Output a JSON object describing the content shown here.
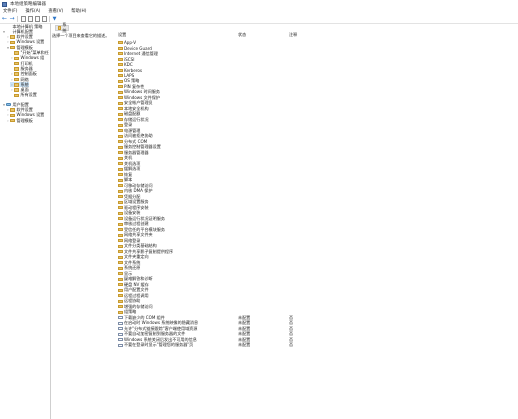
{
  "window": {
    "title": "本地组策略编辑器"
  },
  "menu": [
    "文件(F)",
    "操作(A)",
    "查看(V)",
    "帮助(H)"
  ],
  "toolbar": {
    "icons": [
      "back-arrow-icon",
      "forward-arrow-icon",
      "show-hide-tree-icon",
      "properties-icon",
      "help-icon",
      "export-list-icon",
      "filter-icon"
    ]
  },
  "tree": {
    "items": [
      {
        "label": "本地计算机 策略",
        "icon": "computer",
        "expander": ""
      },
      {
        "label": "计算机配置",
        "icon": "computer",
        "expander": "▾"
      },
      {
        "label": "软件设置",
        "icon": "folder",
        "expander": "›"
      },
      {
        "label": "Windows 设置",
        "icon": "folder",
        "expander": "›"
      },
      {
        "label": "管理模板",
        "icon": "folder",
        "expander": "▾"
      },
      {
        "label": "\"开始\"菜单和任",
        "icon": "folder",
        "expander": ""
      },
      {
        "label": "Windows 组",
        "icon": "folder",
        "expander": "›"
      },
      {
        "label": "打印机",
        "icon": "folder",
        "expander": ""
      },
      {
        "label": "服务器",
        "icon": "folder",
        "expander": ""
      },
      {
        "label": "控制面板",
        "icon": "folder",
        "expander": "›"
      },
      {
        "label": "网络",
        "icon": "folder",
        "expander": "›"
      },
      {
        "label": "系统",
        "icon": "folder",
        "expander": "›",
        "selected": true
      },
      {
        "label": "桌面",
        "icon": "folder",
        "expander": "›"
      },
      {
        "label": "所有设置",
        "icon": "folder",
        "expander": ""
      },
      {
        "label": "用户配置",
        "icon": "user",
        "expander": "▾"
      },
      {
        "label": "软件设置",
        "icon": "folder",
        "expander": "›"
      },
      {
        "label": "Windows 设置",
        "icon": "folder",
        "expander": "›"
      },
      {
        "label": "管理模板",
        "icon": "folder",
        "expander": "›"
      }
    ]
  },
  "tab": {
    "label": "系统"
  },
  "description": "选择一个项目来查看它的描述。",
  "columns": {
    "setting": "设置",
    "state": "状态",
    "comment": "注释"
  },
  "rows": [
    {
      "name": "App-V",
      "type": "folder"
    },
    {
      "name": "Device Guard",
      "type": "folder"
    },
    {
      "name": "Internet 通信管理",
      "type": "folder"
    },
    {
      "name": "iSCSI",
      "type": "folder"
    },
    {
      "name": "KDC",
      "type": "folder"
    },
    {
      "name": "Kerberos",
      "type": "folder"
    },
    {
      "name": "LAPS",
      "type": "folder"
    },
    {
      "name": "OS 策略",
      "type": "folder"
    },
    {
      "name": "PIN 复杂性",
      "type": "folder"
    },
    {
      "name": "Windows 时间服务",
      "type": "folder"
    },
    {
      "name": "Windows 文件保护",
      "type": "folder"
    },
    {
      "name": "安全帐户管理员",
      "type": "folder"
    },
    {
      "name": "本地安全机构",
      "type": "folder"
    },
    {
      "name": "磁盘配额",
      "type": "folder"
    },
    {
      "name": "存储运行状况",
      "type": "folder"
    },
    {
      "name": "登录",
      "type": "folder"
    },
    {
      "name": "电源管理",
      "type": "folder"
    },
    {
      "name": "访问被拒绝协助",
      "type": "folder"
    },
    {
      "name": "分布式 COM",
      "type": "folder"
    },
    {
      "name": "服务控制管理器设置",
      "type": "folder"
    },
    {
      "name": "服务器管理器",
      "type": "folder"
    },
    {
      "name": "关机",
      "type": "folder"
    },
    {
      "name": "关机选项",
      "type": "folder"
    },
    {
      "name": "缓解选项",
      "type": "folder"
    },
    {
      "name": "恢复",
      "type": "folder"
    },
    {
      "name": "脚本",
      "type": "folder"
    },
    {
      "name": "可移动存储访问",
      "type": "folder"
    },
    {
      "name": "内核 DMA 保护",
      "type": "folder"
    },
    {
      "name": "凭据分配",
      "type": "folder"
    },
    {
      "name": "区域设置服务",
      "type": "folder"
    },
    {
      "name": "驱动程序安装",
      "type": "folder"
    },
    {
      "name": "设备安装",
      "type": "folder"
    },
    {
      "name": "设备运行状况证明服务",
      "type": "folder"
    },
    {
      "name": "审核过程创建",
      "type": "folder"
    },
    {
      "name": "受信任的平台模块服务",
      "type": "folder"
    },
    {
      "name": "网络共享文件夹",
      "type": "folder"
    },
    {
      "name": "网络登录",
      "type": "folder"
    },
    {
      "name": "文件分类基础结构",
      "type": "folder"
    },
    {
      "name": "文件共享影子复制提供程序",
      "type": "folder"
    },
    {
      "name": "文件夹重定向",
      "type": "folder"
    },
    {
      "name": "文件系统",
      "type": "folder"
    },
    {
      "name": "系统还原",
      "type": "folder"
    },
    {
      "name": "显示",
      "type": "folder"
    },
    {
      "name": "疑难解答和诊断",
      "type": "folder"
    },
    {
      "name": "硬盘 NV 缓存",
      "type": "folder"
    },
    {
      "name": "用户配置文件",
      "type": "folder"
    },
    {
      "name": "远程过程调用",
      "type": "folder"
    },
    {
      "name": "远程协助",
      "type": "folder"
    },
    {
      "name": "增强的存储访问",
      "type": "folder"
    },
    {
      "name": "组策略",
      "type": "folder"
    },
    {
      "name": "下载缺少的 COM 组件",
      "type": "policy",
      "state": "未配置",
      "comment": "否"
    },
    {
      "name": "在启动时 Windows 系统映像的隐藏消息",
      "type": "policy",
      "state": "未配置",
      "comment": "否"
    },
    {
      "name": "允许\"分布式链接跟踪\"客户端使用域资源",
      "type": "policy",
      "state": "未配置",
      "comment": "否"
    },
    {
      "name": "不要自动加密复制到服务器的文件",
      "type": "policy",
      "state": "未配置",
      "comment": "否"
    },
    {
      "name": "Windows 系统关闭后发出不可用的信息",
      "type": "policy",
      "state": "未配置",
      "comment": "否"
    },
    {
      "name": "不要在登录时显示\"管理您的服务器\"页",
      "type": "policy",
      "state": "未配置",
      "comment": "否"
    }
  ]
}
